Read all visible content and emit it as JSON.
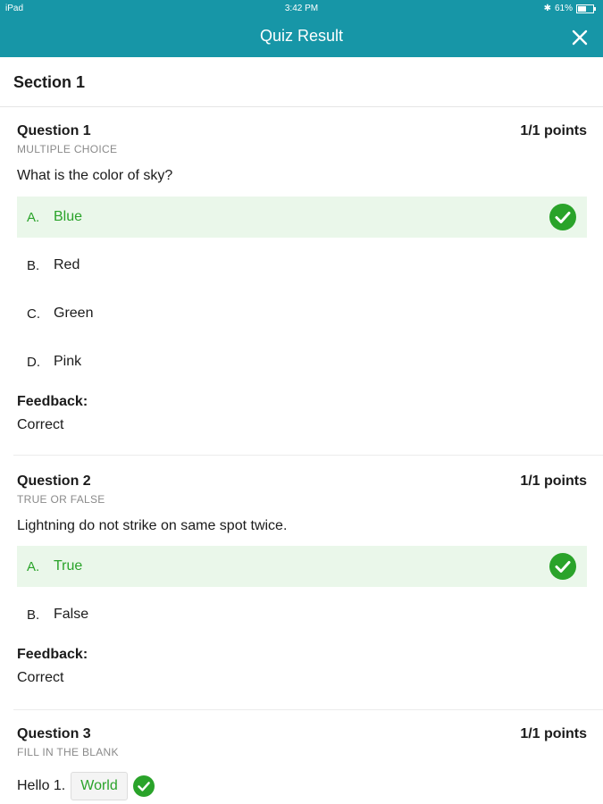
{
  "status": {
    "device": "iPad",
    "time": "3:42 PM",
    "battery": "61%"
  },
  "header": {
    "title": "Quiz Result"
  },
  "section": {
    "title": "Section 1"
  },
  "questions": [
    {
      "title": "Question 1",
      "points": "1/1 points",
      "type": "MULTIPLE CHOICE",
      "text": "What is the color of sky?",
      "options": [
        {
          "letter": "A.",
          "label": "Blue"
        },
        {
          "letter": "B.",
          "label": "Red"
        },
        {
          "letter": "C.",
          "label": "Green"
        },
        {
          "letter": "D.",
          "label": "Pink"
        }
      ],
      "feedback_label": "Feedback:",
      "feedback": "Correct"
    },
    {
      "title": "Question 2",
      "points": "1/1 points",
      "type": "TRUE OR FALSE",
      "text": "Lightning do not strike on same spot twice.",
      "options": [
        {
          "letter": "A.",
          "label": "True"
        },
        {
          "letter": "B.",
          "label": "False"
        }
      ],
      "feedback_label": "Feedback:",
      "feedback": "Correct"
    },
    {
      "title": "Question 3",
      "points": "1/1 points",
      "type": "FILL IN THE BLANK",
      "prefix": "Hello 1.",
      "answer": "World"
    }
  ],
  "colors": {
    "header": "#1796a7",
    "correct": "#2aa32a",
    "selected_bg": "#eaf7ea"
  }
}
